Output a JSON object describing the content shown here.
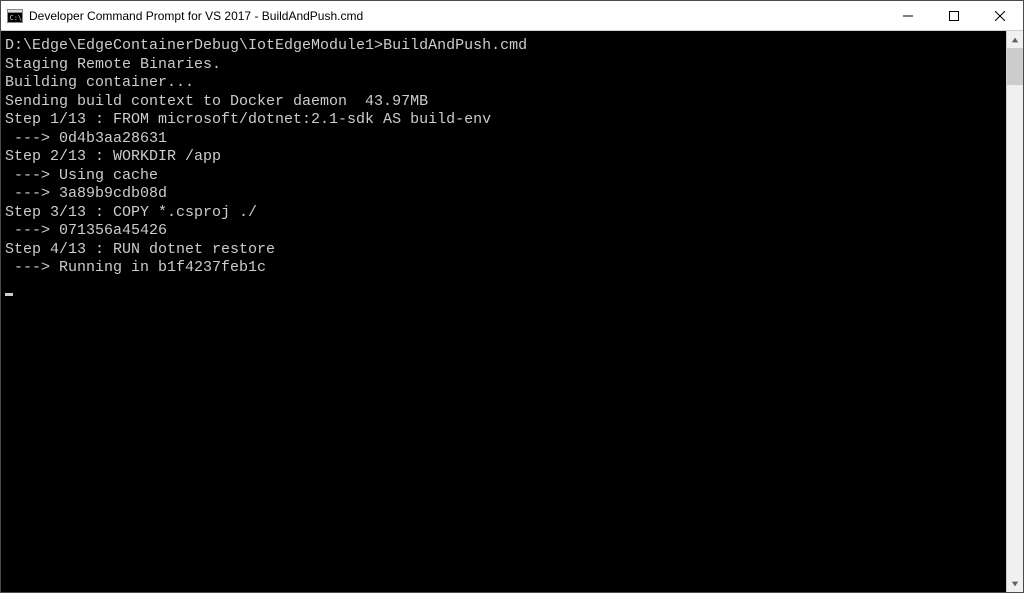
{
  "window": {
    "title": "Developer Command Prompt for VS 2017 - BuildAndPush.cmd"
  },
  "console": {
    "prompt_path": "D:\\Edge\\EdgeContainerDebug\\IotEdgeModule1>",
    "command": "BuildAndPush.cmd",
    "lines": [
      "Staging Remote Binaries.",
      "Building container...",
      "Sending build context to Docker daemon  43.97MB",
      "Step 1/13 : FROM microsoft/dotnet:2.1-sdk AS build-env",
      " ---> 0d4b3aa28631",
      "Step 2/13 : WORKDIR /app",
      " ---> Using cache",
      " ---> 3a89b9cdb08d",
      "Step 3/13 : COPY *.csproj ./",
      " ---> 071356a45426",
      "Step 4/13 : RUN dotnet restore",
      " ---> Running in b1f4237feb1c"
    ]
  }
}
